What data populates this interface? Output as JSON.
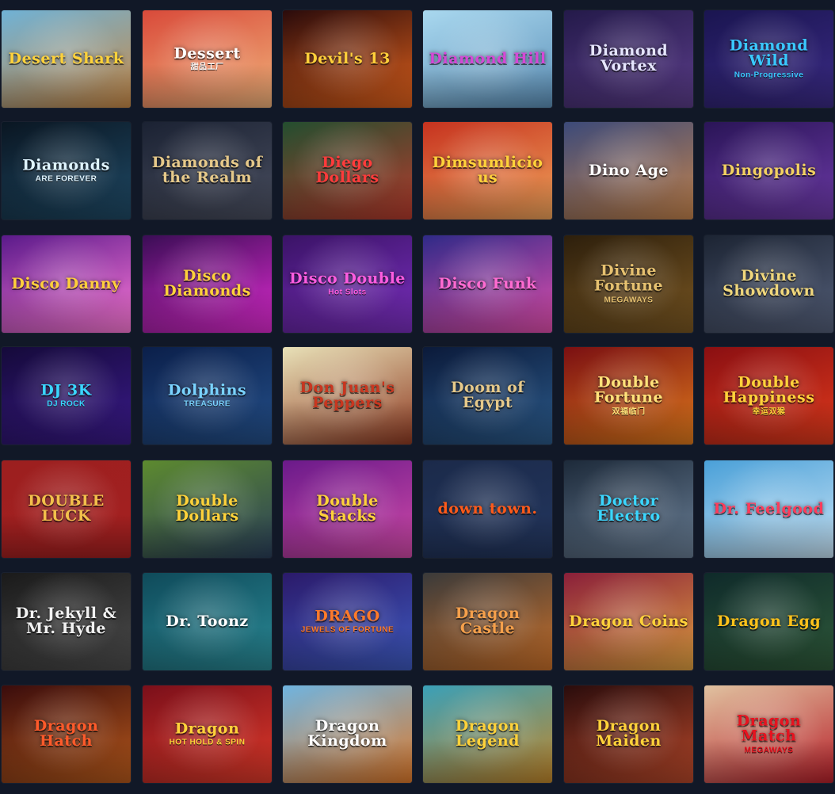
{
  "games": [
    {
      "title": "Desert Shark",
      "subtitle": "",
      "bg": [
        "#6fb2d6",
        "#c98a47"
      ],
      "color": "#ffd23a"
    },
    {
      "title": "Dessert",
      "subtitle": "甜品工厂",
      "bg": [
        "#d94a3a",
        "#f0b27a"
      ],
      "color": "#ffffff"
    },
    {
      "title": "Devil's 13",
      "subtitle": "",
      "bg": [
        "#2a0b0b",
        "#e0611c"
      ],
      "color": "#ffcf3a"
    },
    {
      "title": "Diamond Hill",
      "subtitle": "",
      "bg": [
        "#a9d8ef",
        "#5d90b8"
      ],
      "color": "#d548d6"
    },
    {
      "title": "Diamond Vortex",
      "subtitle": "",
      "bg": [
        "#241a4a",
        "#5b3d8a"
      ],
      "color": "#e6e6ff"
    },
    {
      "title": "Diamond Wild",
      "subtitle": "Non-Progressive",
      "bg": [
        "#1a1550",
        "#3b2b86"
      ],
      "color": "#3ac8ff"
    },
    {
      "title": "Diamonds",
      "subtitle": "ARE FOREVER",
      "bg": [
        "#0a1622",
        "#1f4a66"
      ],
      "color": "#dff4ff"
    },
    {
      "title": "Diamonds of the Realm",
      "subtitle": "",
      "bg": [
        "#1b2233",
        "#4a4f60"
      ],
      "color": "#e6c98a"
    },
    {
      "title": "Diego Dollars",
      "subtitle": "",
      "bg": [
        "#234e2f",
        "#b73b2d"
      ],
      "color": "#ff3b3b"
    },
    {
      "title": "Dimsumlicious",
      "subtitle": "",
      "bg": [
        "#c6321f",
        "#f0a35a"
      ],
      "color": "#ffd23a"
    },
    {
      "title": "Dino Age",
      "subtitle": "",
      "bg": [
        "#3c4a79",
        "#c4834c"
      ],
      "color": "#ffffff"
    },
    {
      "title": "Dingopolis",
      "subtitle": "",
      "bg": [
        "#2a1557",
        "#6d3aa8"
      ],
      "color": "#f2d061"
    },
    {
      "title": "Disco Danny",
      "subtitle": "",
      "bg": [
        "#5a1a8a",
        "#ff7ad9"
      ],
      "color": "#ffcf3a"
    },
    {
      "title": "Disco Diamonds",
      "subtitle": "",
      "bg": [
        "#3a0d55",
        "#e02bd2"
      ],
      "color": "#ffd23a"
    },
    {
      "title": "Disco Double",
      "subtitle": "Hot Slots",
      "bg": [
        "#3a1366",
        "#7b2fc0"
      ],
      "color": "#ff5ce0"
    },
    {
      "title": "Disco Funk",
      "subtitle": "",
      "bg": [
        "#2f2a87",
        "#e34fae"
      ],
      "color": "#ff6bd1"
    },
    {
      "title": "Divine Fortune",
      "subtitle": "MEGAWAYS",
      "bg": [
        "#2d1f0c",
        "#7a5722"
      ],
      "color": "#e6c170"
    },
    {
      "title": "Divine Showdown",
      "subtitle": "",
      "bg": [
        "#1c2433",
        "#55607a"
      ],
      "color": "#f0d77c"
    },
    {
      "title": "DJ 3K",
      "subtitle": "DJ ROCK",
      "bg": [
        "#150a3a",
        "#3a1a8a"
      ],
      "color": "#3ad6ff"
    },
    {
      "title": "Dolphins",
      "subtitle": "TREASURE",
      "bg": [
        "#0b1f4a",
        "#24508a"
      ],
      "color": "#7ad3ff"
    },
    {
      "title": "Don Juan's Peppers",
      "subtitle": "",
      "bg": [
        "#e8e1b8",
        "#8f3a22"
      ],
      "color": "#c9361f"
    },
    {
      "title": "Doom of Egypt",
      "subtitle": "",
      "bg": [
        "#0b1a3a",
        "#2b5a8a"
      ],
      "color": "#e6c98a"
    },
    {
      "title": "Double Fortune",
      "subtitle": "双福临门",
      "bg": [
        "#7a0f12",
        "#e07a1c"
      ],
      "color": "#ffe27a"
    },
    {
      "title": "Double Happiness",
      "subtitle": "幸运双猴",
      "bg": [
        "#8a0f12",
        "#e03a1c"
      ],
      "color": "#ffd23a"
    },
    {
      "title": "DOUBLE LUCK",
      "subtitle": "",
      "bg": [
        "#9c1f1f",
        "#a52020"
      ],
      "color": "#f2c04b"
    },
    {
      "title": "Double Dollars",
      "subtitle": "",
      "bg": [
        "#5d8a2f",
        "#2a3f5a"
      ],
      "color": "#ffd23a"
    },
    {
      "title": "Double Stacks",
      "subtitle": "",
      "bg": [
        "#6a1a8a",
        "#d14aa8"
      ],
      "color": "#ffd23a"
    },
    {
      "title": "down town.",
      "subtitle": "",
      "bg": [
        "#1b2a4a",
        "#23365e"
      ],
      "color": "#ff5a1a"
    },
    {
      "title": "Doctor Electro",
      "subtitle": "",
      "bg": [
        "#1d2a3a",
        "#6a7f96"
      ],
      "color": "#3ad6ff"
    },
    {
      "title": "Dr. Feelgood",
      "subtitle": "",
      "bg": [
        "#4aa0d8",
        "#c7e3f5"
      ],
      "color": "#ff3b5a"
    },
    {
      "title": "Dr. Jekyll & Mr. Hyde",
      "subtitle": "",
      "bg": [
        "#1a1a1a",
        "#4d4d4d"
      ],
      "color": "#f2f2f2"
    },
    {
      "title": "Dr. Toonz",
      "subtitle": "",
      "bg": [
        "#0f4a5a",
        "#2a8a96"
      ],
      "color": "#ffffff"
    },
    {
      "title": "DRAGO",
      "subtitle": "JEWELS OF FORTUNE",
      "bg": [
        "#2b1a6a",
        "#3e5ac0"
      ],
      "color": "#ff7a2a"
    },
    {
      "title": "Dragon Castle",
      "subtitle": "",
      "bg": [
        "#3a3a3a",
        "#c9702a"
      ],
      "color": "#f5a04b"
    },
    {
      "title": "Dragon Coins",
      "subtitle": "",
      "bg": [
        "#8a1f3a",
        "#e0a040"
      ],
      "color": "#ffd23a"
    },
    {
      "title": "Dragon Egg",
      "subtitle": "",
      "bg": [
        "#0f2a2a",
        "#2f5a3a"
      ],
      "color": "#ffc21a"
    },
    {
      "title": "Dragon Hatch",
      "subtitle": "",
      "bg": [
        "#3a0c0c",
        "#b85a1c"
      ],
      "color": "#ff5a2a"
    },
    {
      "title": "Dragon",
      "subtitle": "HOT HOLD & SPIN",
      "bg": [
        "#7a0f1a",
        "#e03a2a"
      ],
      "color": "#ffd23a"
    },
    {
      "title": "Dragon Kingdom",
      "subtitle": "",
      "bg": [
        "#6fb4e0",
        "#e07a2a"
      ],
      "color": "#ffffff"
    },
    {
      "title": "Dragon Legend",
      "subtitle": "",
      "bg": [
        "#3aa0b8",
        "#c2872a"
      ],
      "color": "#ffd23a"
    },
    {
      "title": "Dragon Maiden",
      "subtitle": "",
      "bg": [
        "#2a0c0c",
        "#b8482a"
      ],
      "color": "#ffd23a"
    },
    {
      "title": "Dragon Match",
      "subtitle": "MEGAWAYS",
      "bg": [
        "#e0c2a0",
        "#b8202a"
      ],
      "color": "#e8121f"
    }
  ]
}
